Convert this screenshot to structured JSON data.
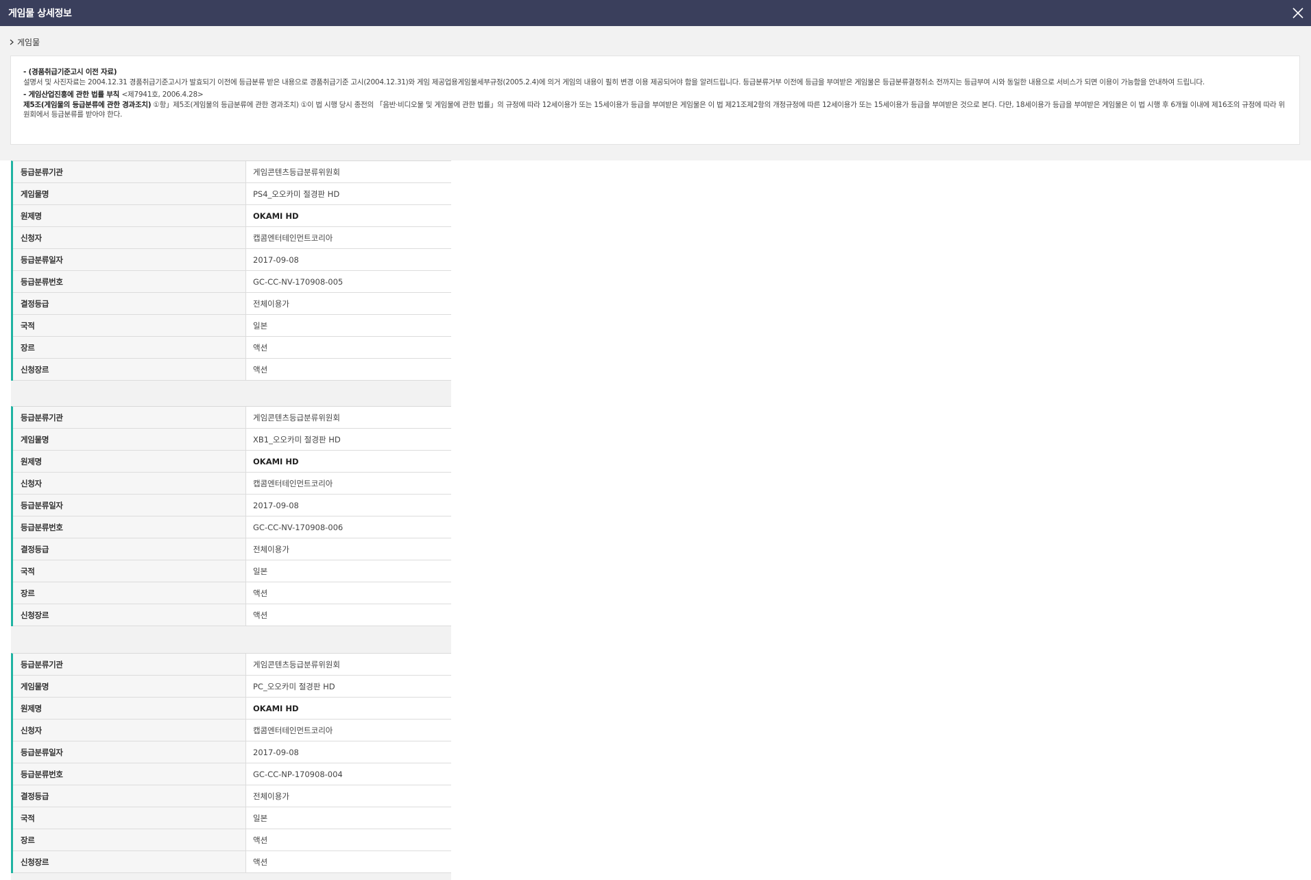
{
  "window": {
    "title": "게임물 상세정보"
  },
  "breadcrumb": {
    "label": "게임물"
  },
  "notice": {
    "heading1": "- (경품취급기준고시 이전 자료)",
    "text1": "설명서 및 사진자료는 2004.12.31 경품취급기준고시가 발효되기 이전에 등급분류 받은 내용으로 경품취급기준 고시(2004.12.31)와 게임 제공업용게임물세부규정(2005.2.4)에 의거 게임의 내용이 필히 변경 이용 제공되어야 함을 알려드립니다. 등급분류거부 이전에 등급을 부여받은 게임물은 등급분류결정취소 전까지는 등급부여 시와 동일한 내용으로 서비스가 되면 이용이 가능함을 안내하여 드립니다.",
    "heading2": "- 게임산업진흥에 관한 법률 부칙 ",
    "heading2_sub": "<제7941호, 2006.4.28>",
    "heading3": "제5조(게임물의 등급분류에 관한 경과조치)",
    "text2": " ①항」제5조(게임물의 등급분류에 관한 경과조치) ①이 법 시행 당시 종전의 「음반·비디오물 및 게임물에 관한 법률」의 규정에 따라 12세이용가 또는 15세이용가 등급을 부여받은 게임물은 이 법 제21조제2항의 개정규정에 따른 12세이용가 또는 15세이용가 등급을 부여받은 것으로 본다. 다만, 18세이용가 등급을 부여받은 게임물은 이 법 시행 후 6개월 이내에 제16조의 규정에 따라 위원회에서 등급분류를 받아야 한다."
  },
  "labels": {
    "agency": "등급분류기관",
    "game_name": "게임물명",
    "original_title": "원제명",
    "applicant": "신청자",
    "rating_date": "등급분류일자",
    "rating_number": "등급분류번호",
    "decided_rating": "결정등급",
    "nationality": "국적",
    "genre": "장르",
    "applied_genre": "신청장르"
  },
  "records": [
    {
      "agency": "게임콘텐츠등급분류위원회",
      "game_name": "PS4_오오카미 절경판 HD",
      "original_title": "OKAMI HD",
      "applicant": "캡콤엔터테인먼트코리아",
      "rating_date": "2017-09-08",
      "rating_number": "GC-CC-NV-170908-005",
      "decided_rating": "전체이용가",
      "nationality": "일본",
      "genre": "액션",
      "applied_genre": "액션"
    },
    {
      "agency": "게임콘텐츠등급분류위원회",
      "game_name": "XB1_오오카미 절경판 HD",
      "original_title": "OKAMI HD",
      "applicant": "캡콤엔터테인먼트코리아",
      "rating_date": "2017-09-08",
      "rating_number": "GC-CC-NV-170908-006",
      "decided_rating": "전체이용가",
      "nationality": "일본",
      "genre": "액션",
      "applied_genre": "액션"
    },
    {
      "agency": "게임콘텐츠등급분류위원회",
      "game_name": "PC_오오카미 절경판 HD",
      "original_title": "OKAMI HD",
      "applicant": "캡콤엔터테인먼트코리아",
      "rating_date": "2017-09-08",
      "rating_number": "GC-CC-NP-170908-004",
      "decided_rating": "전체이용가",
      "nationality": "일본",
      "genre": "액션",
      "applied_genre": "액션"
    }
  ],
  "icons": {
    "close": "close-icon",
    "breadcrumb": "chevron-right-icon"
  },
  "colors": {
    "titlebar": "#3a3f5c",
    "accent": "#1fb3a2"
  }
}
